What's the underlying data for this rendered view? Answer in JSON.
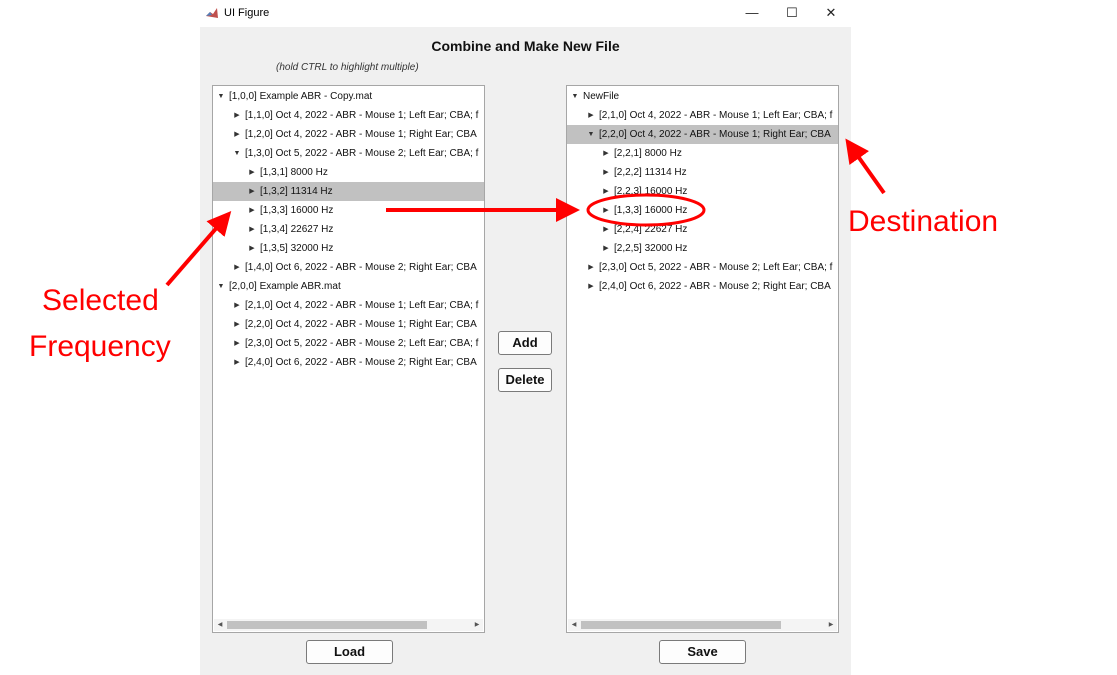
{
  "window": {
    "title": "UI Figure",
    "controls": {
      "minimize": "—",
      "maximize": "☐",
      "close": "✕"
    }
  },
  "header": {
    "title": "Combine and Make New File",
    "hint": "(hold CTRL to highlight multiple)"
  },
  "left_tree": {
    "selected_index": 5,
    "items": [
      {
        "label": "[1,0,0] Example ABR - Copy.mat",
        "level": 0,
        "expanded": true
      },
      {
        "label": "[1,1,0] Oct 4, 2022 - ABR - Mouse 1; Left Ear; CBA; f",
        "level": 1,
        "expanded": false
      },
      {
        "label": "[1,2,0] Oct 4, 2022 - ABR - Mouse 1; Right Ear; CBA",
        "level": 1,
        "expanded": false
      },
      {
        "label": "[1,3,0] Oct 5, 2022 - ABR - Mouse 2; Left Ear; CBA; f",
        "level": 1,
        "expanded": true
      },
      {
        "label": "[1,3,1] 8000 Hz",
        "level": 2,
        "expanded": false
      },
      {
        "label": "[1,3,2] 11314 Hz",
        "level": 2,
        "expanded": false
      },
      {
        "label": "[1,3,3] 16000 Hz",
        "level": 2,
        "expanded": false
      },
      {
        "label": "[1,3,4] 22627 Hz",
        "level": 2,
        "expanded": false
      },
      {
        "label": "[1,3,5] 32000 Hz",
        "level": 2,
        "expanded": false
      },
      {
        "label": "[1,4,0] Oct 6, 2022 - ABR - Mouse 2; Right Ear; CBA",
        "level": 1,
        "expanded": false
      },
      {
        "label": "[2,0,0] Example ABR.mat",
        "level": 0,
        "expanded": true
      },
      {
        "label": "[2,1,0] Oct 4, 2022 - ABR - Mouse 1; Left Ear; CBA; f",
        "level": 1,
        "expanded": false
      },
      {
        "label": "[2,2,0] Oct 4, 2022 - ABR - Mouse 1; Right Ear; CBA",
        "level": 1,
        "expanded": false
      },
      {
        "label": "[2,3,0] Oct 5, 2022 - ABR - Mouse 2; Left Ear; CBA; f",
        "level": 1,
        "expanded": false
      },
      {
        "label": "[2,4,0] Oct 6, 2022 - ABR - Mouse 2; Right Ear; CBA",
        "level": 1,
        "expanded": false
      }
    ]
  },
  "right_tree": {
    "selected_index": 2,
    "items": [
      {
        "label": "NewFile",
        "level": 0,
        "expanded": true
      },
      {
        "label": "[2,1,0] Oct 4, 2022 - ABR - Mouse 1; Left Ear; CBA; f",
        "level": 1,
        "expanded": false
      },
      {
        "label": "[2,2,0] Oct 4, 2022 - ABR - Mouse 1; Right Ear; CBA",
        "level": 1,
        "expanded": true
      },
      {
        "label": "[2,2,1] 8000 Hz",
        "level": 2,
        "expanded": false
      },
      {
        "label": "[2,2,2] 11314 Hz",
        "level": 2,
        "expanded": false
      },
      {
        "label": "[2,2,3] 16000 Hz",
        "level": 2,
        "expanded": false
      },
      {
        "label": "[1,3,3] 16000 Hz",
        "level": 2,
        "expanded": false
      },
      {
        "label": "[2,2,4] 22627 Hz",
        "level": 2,
        "expanded": false
      },
      {
        "label": "[2,2,5] 32000 Hz",
        "level": 2,
        "expanded": false
      },
      {
        "label": "[2,3,0] Oct 5, 2022 - ABR - Mouse 2; Left Ear; CBA; f",
        "level": 1,
        "expanded": false
      },
      {
        "label": "[2,4,0] Oct 6, 2022 - ABR - Mouse 2; Right Ear; CBA",
        "level": 1,
        "expanded": false
      }
    ]
  },
  "buttons": {
    "add": "Add",
    "delete": "Delete",
    "load": "Load",
    "save": "Save"
  },
  "annotations": {
    "selected_line1": "Selected",
    "selected_line2": "Frequency",
    "destination": "Destination",
    "color": "#ff0000"
  }
}
